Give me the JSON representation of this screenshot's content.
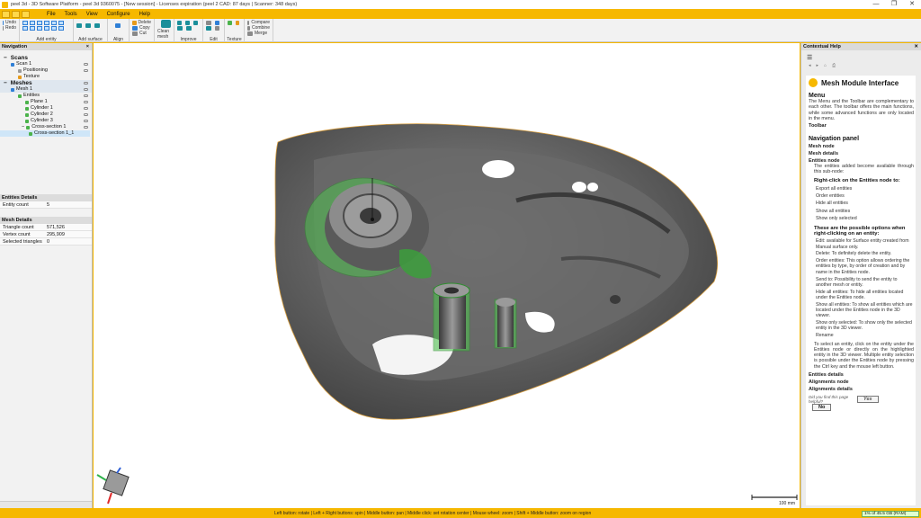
{
  "window": {
    "title": "peel 3d - 3D Software Platform - peel 3d 9360075 - [New session] - Licenses expiration (peel 2 CAD: 87 days | Scanner: 348 days)",
    "controls": [
      "—",
      "❐",
      "✕"
    ]
  },
  "menu": [
    "File",
    "Tools",
    "View",
    "Configure",
    "Help"
  ],
  "ribbon": {
    "undo": "Undo",
    "redo": "Redo",
    "groups": {
      "add_entity": "Add entity",
      "add_surface": "Add surface",
      "align": "Align",
      "delete": "Delete",
      "copy": "Copy",
      "cut": "Cut",
      "clean_mesh": "Clean mesh",
      "improve": "Improve",
      "edit": "Edit",
      "texture": "Texture",
      "compare": "Compare",
      "combine": "Combine",
      "merge": "Merge"
    }
  },
  "navigation": {
    "header": "Navigation",
    "scans": "Scans",
    "scan1": "Scan 1",
    "positioning": "Positioning",
    "texture": "Texture",
    "meshes": "Meshes",
    "mesh1": "Mesh 1",
    "entities": "Entities",
    "plane1": "Plane 1",
    "cylinder1": "Cylinder 1",
    "cylinder2": "Cylinder 2",
    "cylinder3": "Cylinder 3",
    "cross_section1": "Cross-section 1",
    "cross_section1_1": "Cross-section 1_1"
  },
  "entities_details": {
    "header": "Entities Details",
    "entity_count_label": "Entity count",
    "entity_count": "5"
  },
  "mesh_details": {
    "header": "Mesh Details",
    "triangle_count_label": "Triangle count",
    "triangle_count": "571,526",
    "vertex_count_label": "Vertex count",
    "vertex_count": "295,909",
    "selected_triangles_label": "Selected triangles",
    "selected_triangles": "0"
  },
  "viewport": {
    "scale_label": "100 mm"
  },
  "help": {
    "header": "Contextual Help",
    "title": "Mesh Module Interface",
    "menu_heading": "Menu",
    "menu_text": "The Menu and the Toolbar are complementary to each other. The toolbar offers the main functions, while some advanced functions are only located in the menu.",
    "toolbar": "Toolbar",
    "nav_panel": "Navigation panel",
    "mesh_node": "Mesh node",
    "mesh_details": "Mesh details",
    "entities_node": "Entities node",
    "entities_node_text": "The entities added become available through this sub-node:",
    "right_click_node": "Right-click on the Entities node to:",
    "node_actions": [
      "Export all entities",
      "Order entities",
      "Hide all entities",
      "Show all entities",
      "Show only selected"
    ],
    "right_click_entity": "These are the possible options when right-clicking on an entity:",
    "entity_actions": [
      "Edit: available for Surface entity created from Manual surface only.",
      "Delete: To definitely delete the entity.",
      "Order entities: This option allows ordering the entities by type, by order of creation and by name in the Entities node.",
      "Send to: Possibility to send the entity to another mesh or entity.",
      "Hide all entities: To hide all entities located under the Entities node.",
      "Show all entities: To show all entities which are located under the Entities node in the 3D viewer.",
      "Show only selected: To show only the selected entity in the 3D viewer.",
      "Rename"
    ],
    "select_text": "To select an entity, click on the entity under the Entities node or directly on the highlighted entity in the 3D viewer. Multiple entity selection is possible under the Entities node by pressing the Ctrl key and the mouse left button.",
    "entities_details": "Entities details",
    "alignments_node": "Alignments node",
    "alignments_details": "Alignments details",
    "feedback_q": "Did you find this page helpful?",
    "yes": "Yes",
    "no": "No"
  },
  "statusbar": {
    "hint": "Left button: rotate  |  Left + Right buttons: spin  |  Middle button: pan  |  Middle click: set rotation center  |  Mouse wheel: zoom  |  Shift + Middle button: zoom on region",
    "memory": "1% of 45.5 GB (RAM)"
  },
  "colors": {
    "accent": "#f6b800",
    "entity_green": "#4fc24f",
    "mesh_gray": "#6f6f6f"
  }
}
